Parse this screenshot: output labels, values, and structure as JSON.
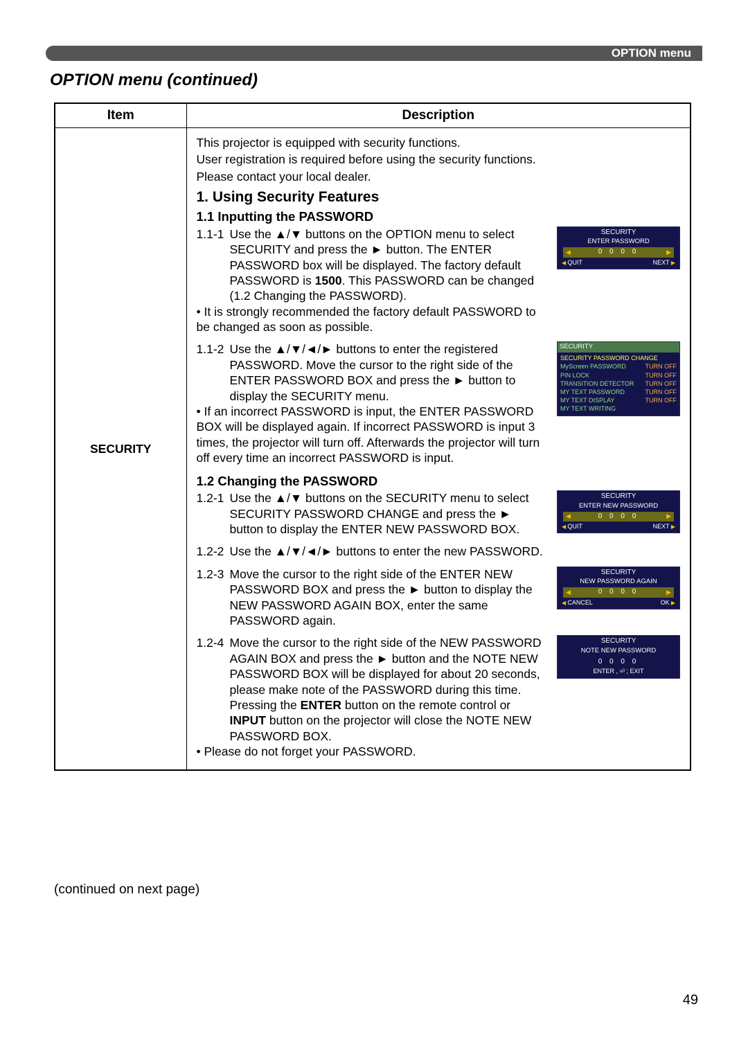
{
  "header": {
    "menu_label": "OPTION menu"
  },
  "section_title": "OPTION menu (continued)",
  "table": {
    "col_item": "Item",
    "col_desc": "Description",
    "item_label": "SECURITY",
    "intro1": "This projector is equipped with security functions.",
    "intro2": "User registration is required before using the security functions.",
    "intro3": "Please contact your local dealer.",
    "h1": "1. Using Security Features",
    "s11": "1.1 Inputting the PASSWORD",
    "s11_1_num": "1.1-1",
    "s11_1_a": "Use the ▲/▼ buttons on the OPTION menu to select SECURITY and press the ► button. The ENTER PASSWORD box will be displayed. The factory default PASSWORD is ",
    "s11_1_bold": "1500",
    "s11_1_b": ". This PASSWORD can be changed (1.2 Changing the PASSWORD).",
    "s11_note": "• It is strongly recommended the factory default PASSWORD to be changed as soon as possible.",
    "s11_2_num": "1.1-2",
    "s11_2": "Use the ▲/▼/◄/► buttons to enter the registered PASSWORD. Move the cursor to the right side of the ENTER PASSWORD BOX and press the ► button to display the SECURITY menu.",
    "s11_2_note": "• If an incorrect PASSWORD is input, the ENTER PASSWORD BOX will be displayed again. If incorrect PASSWORD is input 3 times, the projector will turn off. Afterwards the projector will turn off every time an incorrect PASSWORD is input.",
    "s12": "1.2 Changing the PASSWORD",
    "s12_1_num": "1.2-1",
    "s12_1": "Use the ▲/▼ buttons on the SECURITY menu to select SECURITY PASSWORD CHANGE and press the ► button to display the ENTER NEW PASSWORD BOX.",
    "s12_2_num": "1.2-2",
    "s12_2": "Use the ▲/▼/◄/► buttons to enter the new PASSWORD.",
    "s12_3_num": "1.2-3",
    "s12_3": "Move the cursor to the right side of the ENTER NEW PASSWORD BOX and press the ► button to display the NEW PASSWORD AGAIN BOX, enter the same PASSWORD again.",
    "s12_4_num": "1.2-4",
    "s12_4_a": "Move the cursor to the right side of the NEW PASSWORD AGAIN BOX and press the ► button and the NOTE NEW PASSWORD BOX will be displayed for about 20 seconds, please make note of the PASSWORD during this time. Pressing the ",
    "s12_4_b1": "ENTER",
    "s12_4_b": " button on the remote control or ",
    "s12_4_b2": "INPUT",
    "s12_4_c": " button on the projector will close the NOTE NEW PASSWORD BOX.",
    "s12_note": "• Please do not forget your PASSWORD."
  },
  "osd": {
    "enter_pw": {
      "title": "SECURITY",
      "sub": "ENTER PASSWORD",
      "digits": "0 0 0 0",
      "quit": "QUIT",
      "next": "NEXT"
    },
    "sec_menu": {
      "hdr": "SECURITY",
      "rows": [
        {
          "lbl": "SECURITY PASSWORD CHANGE",
          "st": ""
        },
        {
          "lbl": "MyScreen PASSWORD",
          "st": "TURN OFF"
        },
        {
          "lbl": "PIN LOCK",
          "st": "TURN OFF"
        },
        {
          "lbl": "TRANSITION DETECTOR",
          "st": "TURN OFF"
        },
        {
          "lbl": "MY TEXT PASSWORD",
          "st": "TURN OFF"
        },
        {
          "lbl": "MY TEXT DISPLAY",
          "st": "TURN OFF"
        },
        {
          "lbl": "MY TEXT WRITING",
          "st": ""
        }
      ]
    },
    "enter_new_pw": {
      "title": "SECURITY",
      "sub": "ENTER NEW PASSWORD",
      "digits": "0 0 0 0",
      "quit": "QUIT",
      "next": "NEXT"
    },
    "new_pw_again": {
      "title": "SECURITY",
      "sub": "NEW PASSWORD AGAIN",
      "digits": "0 0 0 0",
      "cancel": "CANCEL",
      "ok": "OK"
    },
    "note_new_pw": {
      "title": "SECURITY",
      "sub": "NOTE NEW PASSWORD",
      "digits": "0 0 0 0",
      "foot": "ENTER , ⏎ ; EXIT"
    }
  },
  "continued": "(continued on next page)",
  "page_number": "49"
}
